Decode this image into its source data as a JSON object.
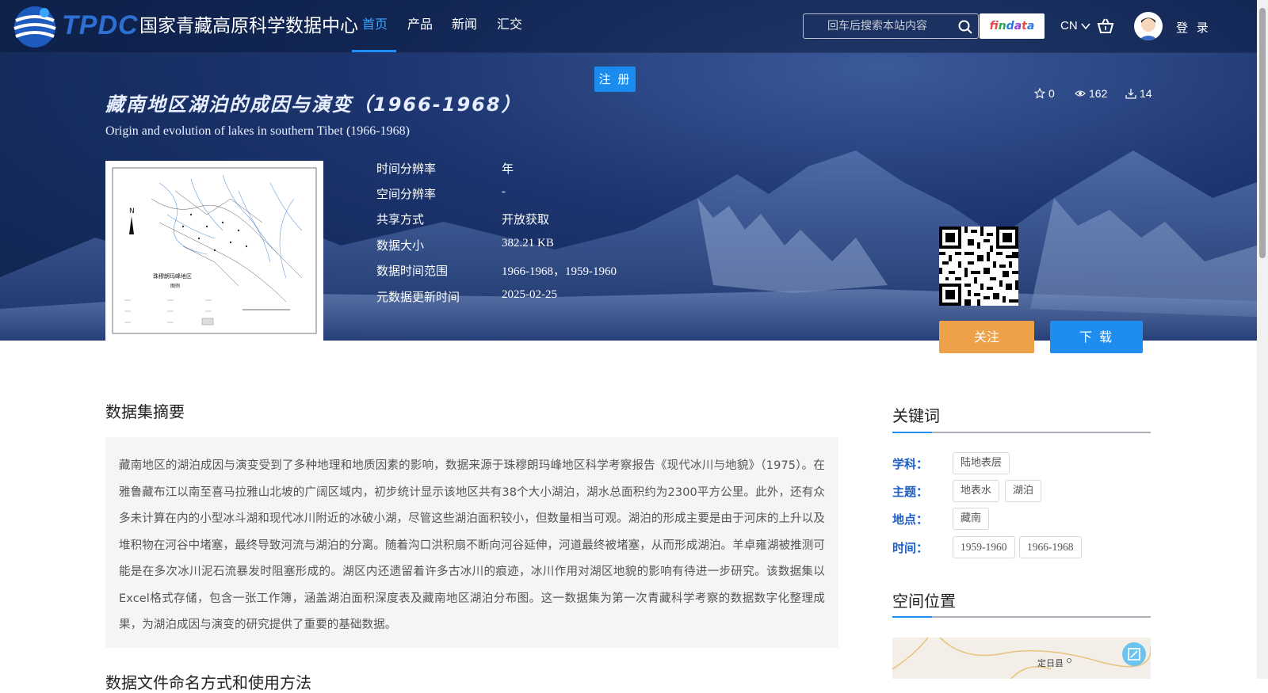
{
  "header": {
    "logo_text": "TPDC",
    "site_name": "国家青藏高原科学数据中心",
    "nav": [
      {
        "label": "首页",
        "active": true
      },
      {
        "label": "产品",
        "active": false
      },
      {
        "label": "新闻",
        "active": false
      },
      {
        "label": "汇交",
        "active": false
      }
    ],
    "search_placeholder": "回车后搜索本站内容",
    "findata_logo": "findata",
    "lang": "CN",
    "login": "登 录",
    "register": "注 册"
  },
  "dataset": {
    "title_cn": "藏南地区湖泊的成因与演变（1966-1968）",
    "title_en": "Origin and evolution of lakes in southern Tibet (1966-1968)",
    "stats": {
      "stars": "0",
      "views": "162",
      "downloads": "14"
    },
    "meta": [
      {
        "key": "时间分辨率",
        "value": "年"
      },
      {
        "key": "空间分辨率",
        "value": "-"
      },
      {
        "key": "共享方式",
        "value": "开放获取"
      },
      {
        "key": "数据大小",
        "value": "382.21 KB"
      },
      {
        "key": "数据时间范围",
        "value": "1966-1968，1959-1960"
      },
      {
        "key": "元数据更新时间",
        "value": "2025-02-25"
      }
    ],
    "thumbnail_caption": "珠穆朗玛峰地区",
    "thumbnail_legend": "图例",
    "follow": "关注",
    "download": "下 载"
  },
  "abstract": {
    "title": "数据集摘要",
    "text": "藏南地区的湖泊成因与演变受到了多种地理和地质因素的影响，数据来源于珠穆朗玛峰地区科学考察报告《现代冰川与地貌》（1975）。在雅鲁藏布江以南至喜马拉雅山北坡的广阔区域内，初步统计显示该地区共有38个大小湖泊，湖水总面积约为2300平方公里。此外，还有众多未计算在内的小型冰斗湖和现代冰川附近的冰破小湖，尽管这些湖泊面积较小，但数量相当可观。湖泊的形成主要是由于河床的上升以及堆积物在河谷中堵塞，最终导致河流与湖泊的分离。随着沟口洪积扇不断向河谷延伸，河道最终被堵塞，从而形成湖泊。羊卓雍湖被推测可能是在多次冰川泥石流暴发时阻塞形成的。湖区内还遗留着许多古冰川的痕迹，冰川作用对湖区地貌的影响有待进一步研究。该数据集以Excel格式存储，包含一张工作簿，涵盖湖泊面积深度表及藏南地区湖泊分布图。这一数据集为第一次青藏科学考察的数据数字化整理成果，为湖泊成因与演变的研究提供了重要的基础数据。",
    "next_title": "数据文件命名方式和使用方法"
  },
  "keywords": {
    "title": "关键词",
    "groups": [
      {
        "label": "学科：",
        "tags": [
          "陆地表层"
        ]
      },
      {
        "label": "主题：",
        "tags": [
          "地表水",
          "湖泊"
        ]
      },
      {
        "label": "地点：",
        "tags": [
          "藏南"
        ]
      },
      {
        "label": "时间：",
        "tags": [
          "1959-1960",
          "1966-1968"
        ]
      }
    ]
  },
  "location": {
    "title": "空间位置",
    "map_label": "定日县"
  }
}
